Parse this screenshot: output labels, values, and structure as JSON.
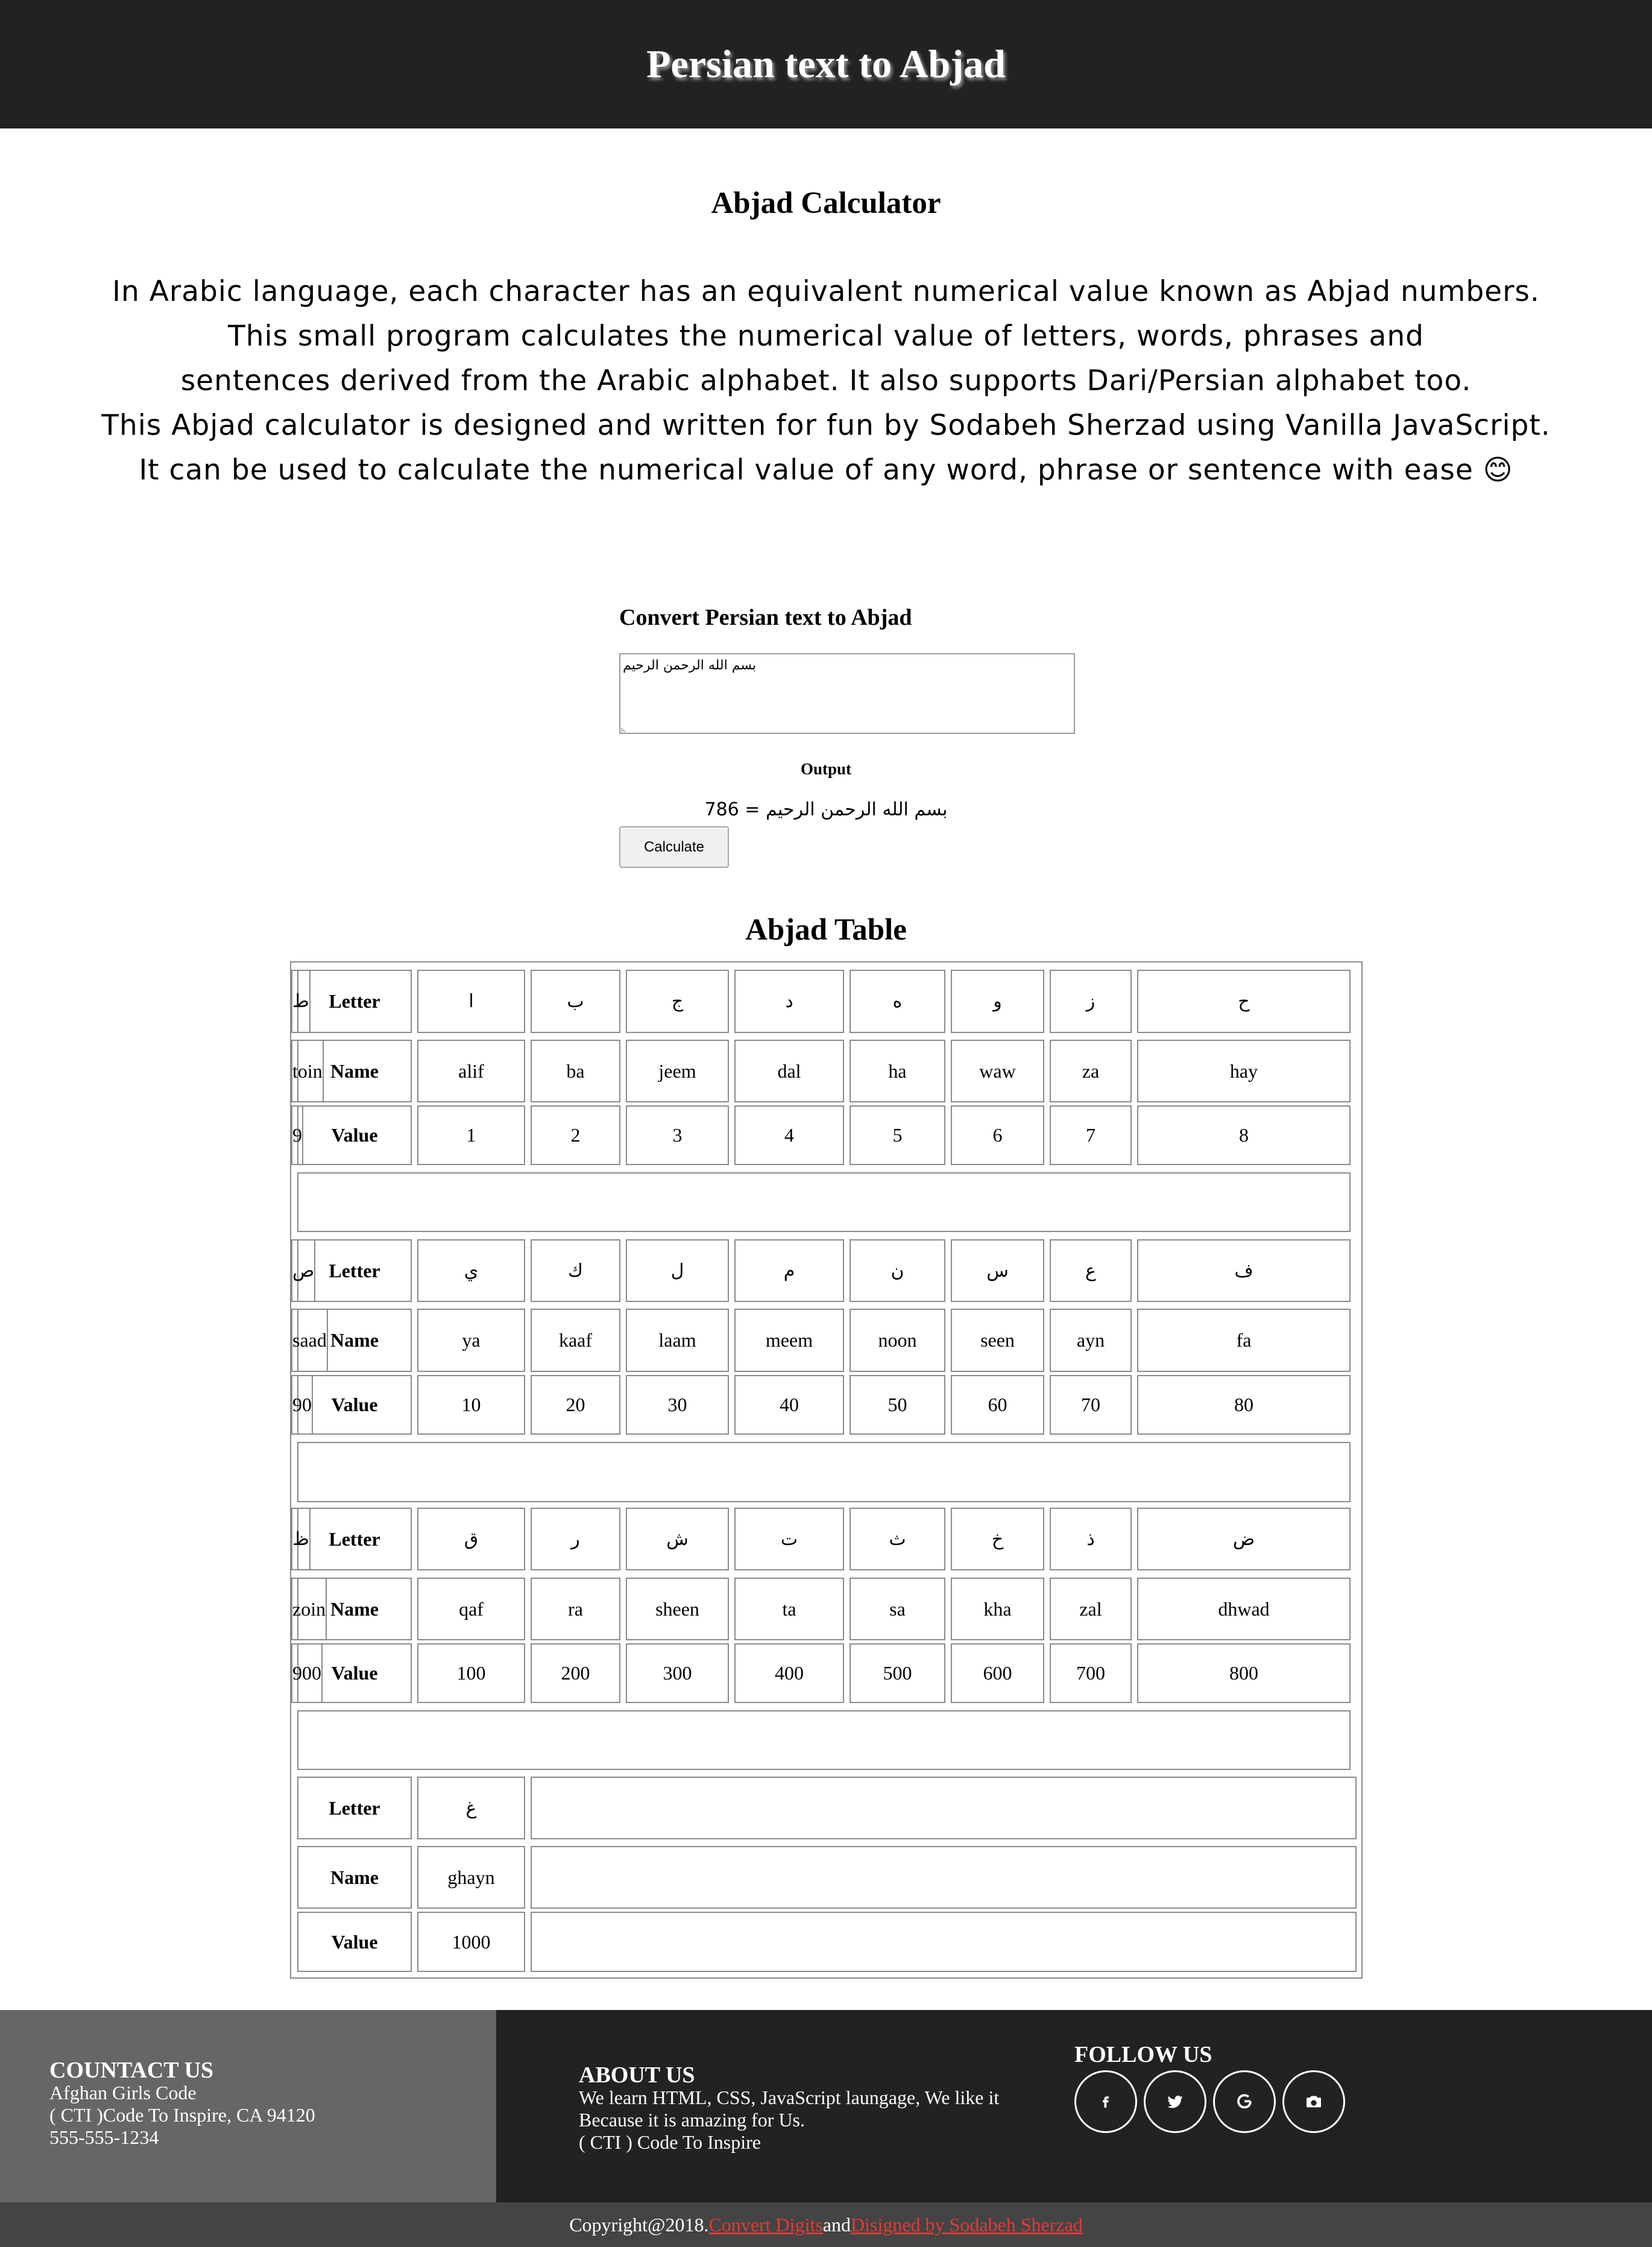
{
  "header": {
    "title": "Persian text to Abjad"
  },
  "intro": {
    "title": "Abjad Calculator",
    "paragraph": "In Arabic language, each character has an equivalent numerical value known as Abjad numbers.\nThis small program calculates the numerical value of letters, words, phrases and\nsentences derived from the Arabic alphabet. It also supports Dari/Persian alphabet too.\nThis Abjad calculator is designed and written for fun by Sodabeh Sherzad using Vanilla JavaScript.\nIt can be used to calculate the numerical value of any word, phrase or sentence with ease 😊"
  },
  "converter": {
    "label": "Convert Persian text to Abjad",
    "input_value": "بسم الله الرحمن الرحيم",
    "output_label": "Output",
    "output_value": "بسم الله الرحمن الرحيم = 786",
    "button_label": "Calculate"
  },
  "abjad_table": {
    "title": "Abjad Table",
    "row_labels": {
      "letter": "Letter",
      "name": "Name",
      "value": "Value"
    },
    "groups": [
      {
        "letters": [
          "ا",
          "ب",
          "ج",
          "د",
          "ه",
          "و",
          "ز",
          "ح",
          "ط"
        ],
        "names": [
          "alif",
          "ba",
          "jeem",
          "dal",
          "ha",
          "waw",
          "za",
          "hay",
          "toin"
        ],
        "values": [
          "1",
          "2",
          "3",
          "4",
          "5",
          "6",
          "7",
          "8",
          "9"
        ]
      },
      {
        "letters": [
          "ي",
          "ك",
          "ل",
          "م",
          "ن",
          "س",
          "ع",
          "ف",
          "ص"
        ],
        "names": [
          "ya",
          "kaaf",
          "laam",
          "meem",
          "noon",
          "seen",
          "ayn",
          "fa",
          "saad"
        ],
        "values": [
          "10",
          "20",
          "30",
          "40",
          "50",
          "60",
          "70",
          "80",
          "90"
        ]
      },
      {
        "letters": [
          "ق",
          "ر",
          "ش",
          "ت",
          "ث",
          "خ",
          "ذ",
          "ض",
          "ظ"
        ],
        "names": [
          "qaf",
          "ra",
          "sheen",
          "ta",
          "sa",
          "kha",
          "zal",
          "dhwad",
          "zoin"
        ],
        "values": [
          "100",
          "200",
          "300",
          "400",
          "500",
          "600",
          "700",
          "800",
          "900"
        ]
      },
      {
        "letters": [
          "غ"
        ],
        "names": [
          "ghayn"
        ],
        "values": [
          "1000"
        ]
      }
    ]
  },
  "footer": {
    "contact": {
      "heading": "COUNTACT US",
      "line1": "Afghan Girls Code",
      "line2": "( CTI )Code To Inspire, CA 94120",
      "line3": "555-555-1234"
    },
    "about": {
      "heading": "ABOUT US",
      "line1": "We learn HTML, CSS, JavaScript laungage, We like it",
      "line2": "Because it is amazing for Us.",
      "line3": "( CTI ) Code To Inspire"
    },
    "follow": {
      "heading": "FOLLOW US",
      "icons": [
        "facebook-icon",
        "twitter-icon",
        "google-icon",
        "camera-icon"
      ]
    },
    "copyright": {
      "prefix": "Copyright@2018.",
      "link1": "Convert Digits",
      "middle": "and",
      "link2": "Disigned by Sodabeh Sherzad"
    }
  },
  "colors": {
    "header_bg": "#222222",
    "footer_left_bg": "#666666",
    "footer_main_bg": "#222222",
    "copyright_bg": "#444444",
    "link": "#e53935"
  }
}
